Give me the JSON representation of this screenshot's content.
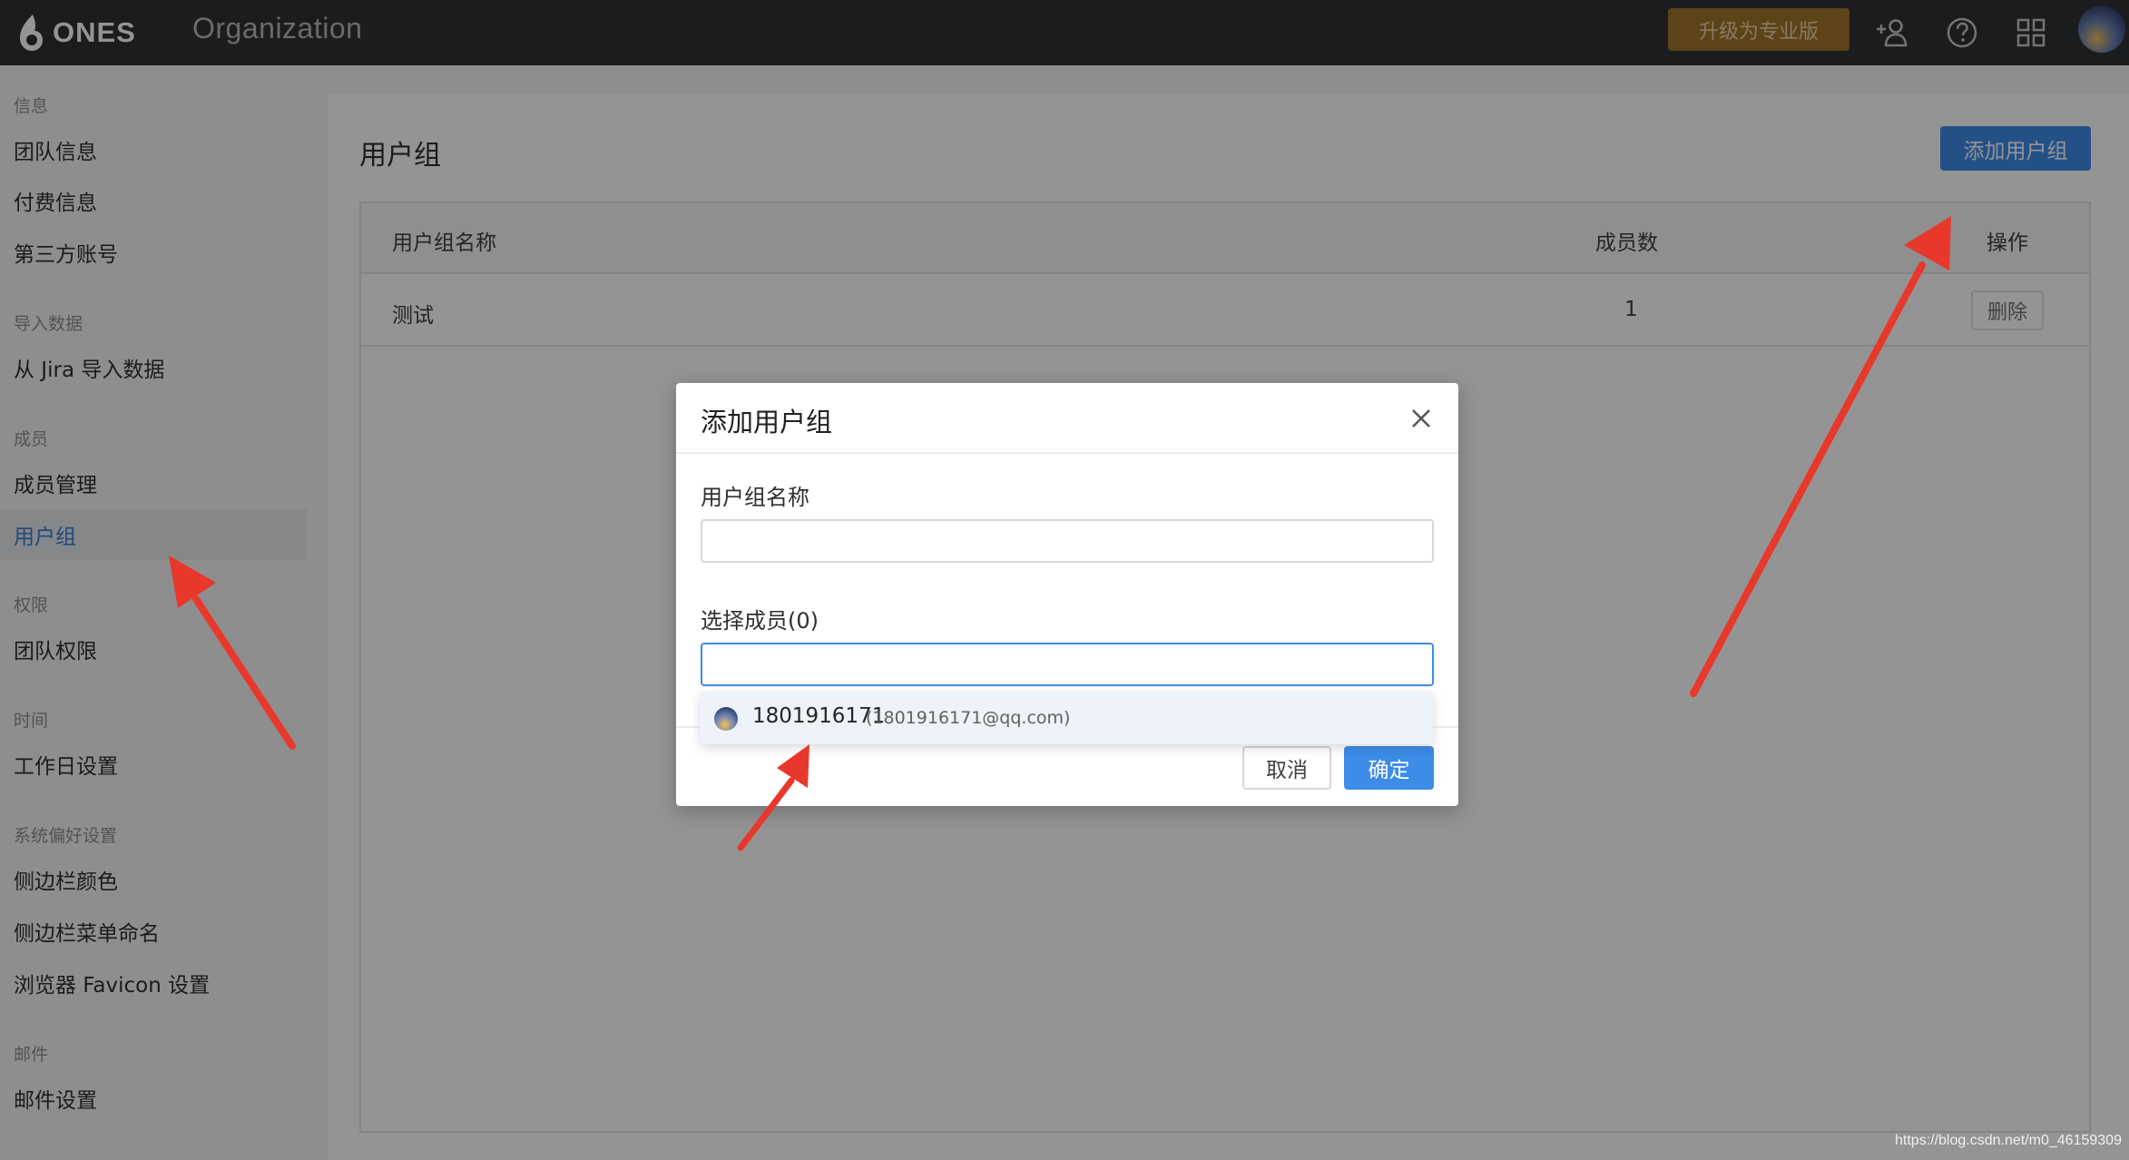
{
  "topbar": {
    "logo_text": "ONES",
    "app_title": "Organization",
    "upgrade_label": "升级为专业版",
    "icons": [
      "add-member-icon",
      "help-icon",
      "apps-grid-icon",
      "avatar"
    ]
  },
  "sidebar": {
    "sections": [
      {
        "label": "信息",
        "items": [
          "团队信息",
          "付费信息",
          "第三方账号"
        ]
      },
      {
        "label": "导入数据",
        "items": [
          "从 Jira 导入数据"
        ]
      },
      {
        "label": "成员",
        "items": [
          "成员管理",
          "用户组"
        ]
      },
      {
        "label": "权限",
        "items": [
          "团队权限"
        ]
      },
      {
        "label": "时间",
        "items": [
          "工作日设置"
        ]
      },
      {
        "label": "系统偏好设置",
        "items": [
          "侧边栏颜色",
          "侧边栏菜单命名",
          "浏览器 Favicon 设置"
        ]
      },
      {
        "label": "邮件",
        "items": [
          "邮件设置"
        ]
      }
    ],
    "active_item": "用户组"
  },
  "main": {
    "title": "用户组",
    "add_button": "添加用户组",
    "table": {
      "columns": [
        "用户组名称",
        "成员数",
        "操作"
      ],
      "rows": [
        {
          "name": "测试",
          "member_count": "1",
          "action": "删除"
        }
      ]
    }
  },
  "dialog": {
    "title": "添加用户组",
    "name_label": "用户组名称",
    "name_value": "",
    "members_label": "选择成员(0)",
    "members_value": "",
    "dropdown_option": {
      "name": "1801916171",
      "email": "(1801916171@qq.com)"
    },
    "cancel_label": "取消",
    "confirm_label": "确定"
  },
  "watermark": "https://blog.csdn.net/m0_46159309",
  "colors": {
    "topbar_bg": "#2f3133",
    "upgrade_bg": "#a0742a",
    "primary_blue": "#3d8ce8",
    "annotation_arrow": "#e8382b"
  }
}
